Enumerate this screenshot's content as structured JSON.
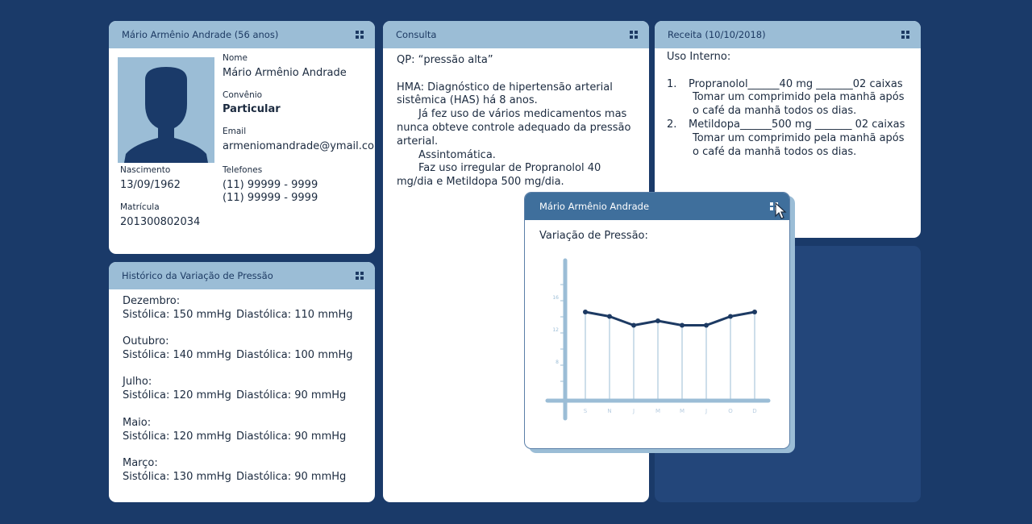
{
  "patient_card": {
    "header": "Mário Armênio Andrade (56 anos)",
    "name_label": "Nome",
    "name": "Mário Armênio Andrade",
    "insurance_label": "Convênio",
    "insurance": "Particular",
    "email_label": "Email",
    "email": "armeniomandrade@ymail.com",
    "birth_label": "Nascimento",
    "birth": "13/09/1962",
    "phone_label": "Telefones",
    "phone1": "(11) 99999 - 9999",
    "phone2": "(11) 99999 - 9999",
    "registration_label": "Matrícula",
    "registration": "201300802034"
  },
  "history_card": {
    "header": "Histórico da Variação de Pressão",
    "entries": [
      {
        "month": "Dezembro:",
        "systolic": "Sistólica: 150 mmHg",
        "diastolic": "Diastólica: 110 mmHg"
      },
      {
        "month": "Outubro:",
        "systolic": "Sistólica: 140 mmHg",
        "diastolic": "Diastólica: 100 mmHg"
      },
      {
        "month": "Julho:",
        "systolic": "Sistólica: 120 mmHg",
        "diastolic": "Diastólica: 90 mmHg"
      },
      {
        "month": "Maio:",
        "systolic": "Sistólica: 120 mmHg",
        "diastolic": "Diastólica: 90 mmHg"
      },
      {
        "month": "Março:",
        "systolic": "Sistólica: 130 mmHg",
        "diastolic": "Diastólica: 90 mmHg"
      }
    ]
  },
  "consult_card": {
    "header": "Consulta",
    "qp": "QP: “pressão alta”",
    "hma": "HMA: Diagnóstico de hipertensão arterial sistêmica (HAS) há 8 anos.",
    "p1": "Já fez uso de vários medicamentos mas nunca obteve controle adequado da pressão arterial.",
    "p2": "Assintomática.",
    "p3": "Faz uso irregular de Propranolol 40 mg/dia e Metildopa 500 mg/dia."
  },
  "rx_card": {
    "header": "Receita (10/10/2018)",
    "usage": "Uso Interno:",
    "items": [
      {
        "num": "1.",
        "drug": "Propranolol______40 mg _______02 caixas",
        "instr": "Tomar um comprimido pela manhã após o café da manhã todos os dias."
      },
      {
        "num": "2.",
        "drug": "Metildopa______500 mg _______ 02 caixas",
        "instr": "Tomar um comprimido pela manhã após o café da manhã todos os dias."
      }
    ]
  },
  "popup": {
    "header": "Mário Armênio Andrade",
    "title": "Variação de Pressão:"
  },
  "chart_data": {
    "type": "line",
    "categories": [
      "S",
      "N",
      "J",
      "M",
      "M",
      "J",
      "O",
      "D"
    ],
    "series": [
      {
        "values": [
          14,
          13.5,
          12.5,
          13,
          12.5,
          12.5,
          13.5,
          14
        ]
      }
    ],
    "y_ticks": [
      "16",
      "12",
      "8"
    ],
    "ylim": [
      4,
      18
    ],
    "grid": false,
    "colors": {
      "line": "#1d3a63",
      "drop": "#9bbdd6",
      "axis": "#9bbdd6"
    }
  }
}
